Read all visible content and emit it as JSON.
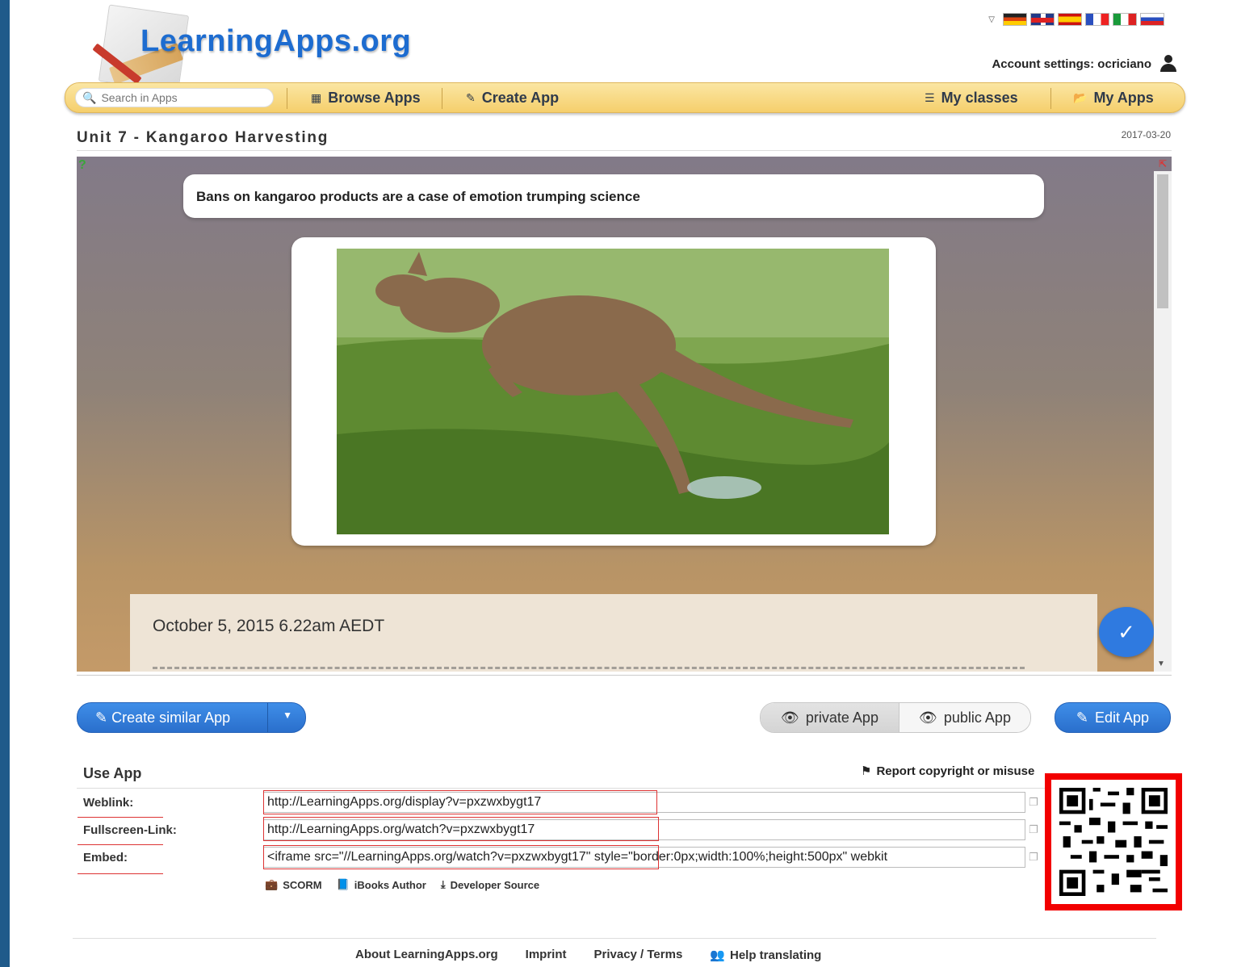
{
  "site": {
    "logo_text": "LearningApps.org",
    "account_label": "Account settings: ocriciano",
    "languages": [
      "de",
      "gb",
      "es",
      "fr",
      "it",
      "ru"
    ]
  },
  "nav": {
    "search_placeholder": "Search in Apps",
    "browse": "Browse Apps",
    "create": "Create App",
    "classes": "My classes",
    "my_apps": "My Apps"
  },
  "app": {
    "title": "Unit 7 - Kangaroo Harvesting",
    "date": "2017-03-20",
    "headline": "Bans on kangaroo products are a case of emotion trumping science",
    "article_date": "October 5, 2015 6.22am AEDT"
  },
  "actions": {
    "create_similar": "Create similar App",
    "private": "private App",
    "public": "public App",
    "edit": "Edit App"
  },
  "use_app": {
    "title": "Use App",
    "report": "Report copyright or misuse",
    "weblink_label": "Weblink:",
    "weblink_value": "http://LearningApps.org/display?v=pxzwxbygt17",
    "fullscreen_label": "Fullscreen-Link:",
    "fullscreen_value": "http://LearningApps.org/watch?v=pxzwxbygt17",
    "embed_label": "Embed:",
    "embed_value": "<iframe src=\"//LearningApps.org/watch?v=pxzwxbygt17\" style=\"border:0px;width:100%;height:500px\" webkit",
    "scorm": "SCORM",
    "ibooks": "iBooks Author",
    "developer": "Developer Source"
  },
  "footer": {
    "about": "About LearningApps.org",
    "imprint": "Imprint",
    "privacy": "Privacy / Terms",
    "help": "Help translating"
  },
  "colors": {
    "accent_blue": "#2a6fcc",
    "nav_yellow": "#f5cf6c",
    "highlight_red": "#f20000"
  }
}
